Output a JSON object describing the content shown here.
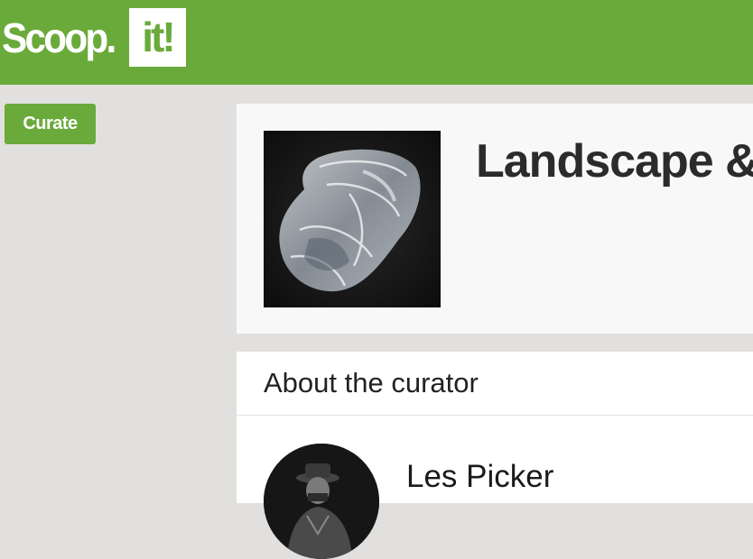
{
  "header": {
    "logo_text": "Scoop.",
    "logo_box_text": "it!",
    "brand_color": "#6aaa3b"
  },
  "sidebar": {
    "curate_label": "Curate"
  },
  "topic": {
    "title": "Landscape &",
    "thumbnail_icon": "plastic-bag-image"
  },
  "about": {
    "heading": "About the curator",
    "curator_name": "Les Picker",
    "avatar_icon": "curator-avatar"
  }
}
